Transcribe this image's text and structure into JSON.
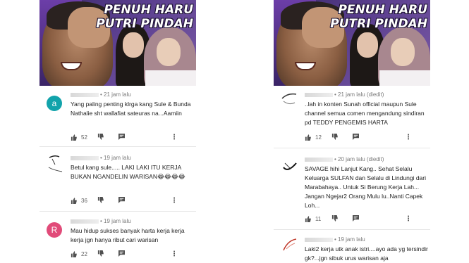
{
  "thumbnail": {
    "title_line1": "PENUH HARU",
    "title_line2": "PUTRI PINDAH"
  },
  "left": {
    "comments": [
      {
        "avatar_letter": "a",
        "avatar_color": "#12a3ab",
        "time": "21 jam lalu",
        "text": "Yang paling penting klrga kang Sule & Bunda Nathalie sht wallafiat sateuras na...Aamiin",
        "likes": "52"
      },
      {
        "avatar_letter": "",
        "time": "19 jam lalu",
        "text": "Betul kang sule..... LAKI LAKI ITU KERJA BUKAN NGANDELIN WARISAN😂😂😂😂",
        "likes": "36"
      },
      {
        "avatar_letter": "R",
        "avatar_color": "#e14b79",
        "time": "19 jam lalu",
        "text": "Mau hidup sukses banyak harta kerja kerja kerja jgn hanya  ribut cari warisan",
        "likes": "22"
      }
    ]
  },
  "right": {
    "comments": [
      {
        "time": "21 jam lalu (diedit)",
        "text": "..lah in konten Sunah official maupun Sule channel semua comen mengandung sindiran pd TEDDY PENGEMIS HARTA",
        "likes": "12"
      },
      {
        "time": "20 jam lalu (diedit)",
        "text": "SAVAGE hihi Lanjut Kang.. Sehat Selalu Keluarga SULFAN dan Selalu di Lindungi dari Marabahaya.. Untuk Si Berung Kerja Lah... Jangan Ngejar2 Orang Mulu lu..Nanti Capek Loh...",
        "likes": "11"
      },
      {
        "time": "19 jam lalu",
        "text": "Laki2 kerja utk anak istri....ayo ada yg tersindir gk?...jgn sibuk urus warisan aja",
        "likes": ""
      }
    ]
  },
  "icons": {
    "like": "thumbs-up-icon",
    "dislike": "thumbs-down-icon",
    "reply": "reply-comment-icon",
    "more": "more-vert-icon"
  }
}
